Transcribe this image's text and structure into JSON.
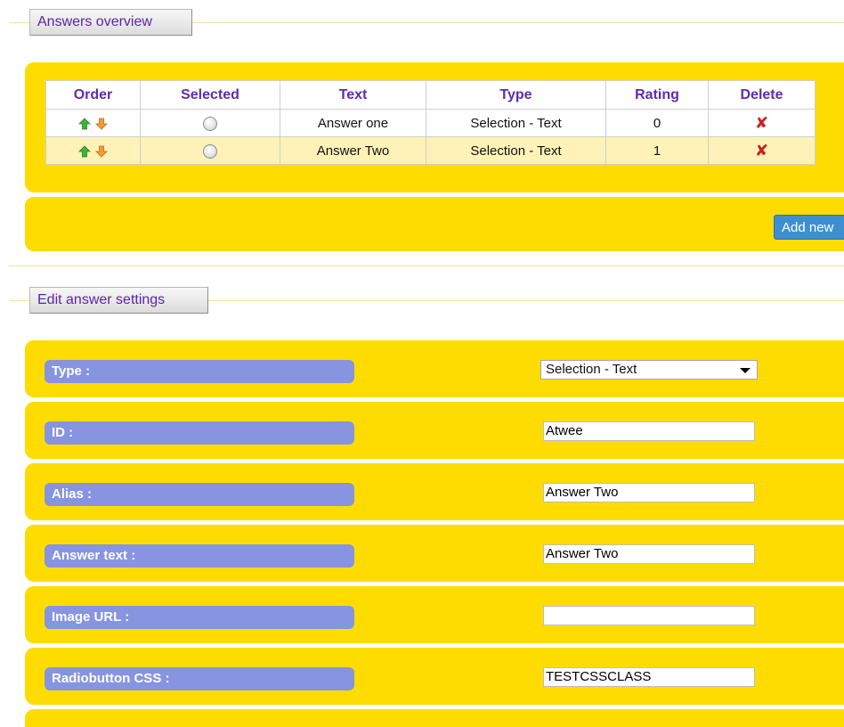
{
  "overview": {
    "legend": "Answers overview",
    "columns": [
      "Order",
      "Selected",
      "Text",
      "Type",
      "Rating",
      "Delete"
    ],
    "rows": [
      {
        "text": "Answer one",
        "type": "Selection - Text",
        "rating": "0",
        "delete_icon": "delete-x-icon"
      },
      {
        "text": "Answer Two",
        "type": "Selection - Text",
        "rating": "1",
        "delete_icon": "delete-x-icon"
      }
    ],
    "delete_glyph": "✘",
    "add_new_label": "Add new"
  },
  "settings": {
    "legend": "Edit answer settings",
    "type_label": "Type :",
    "type_value": "Selection - Text",
    "id_label": "ID :",
    "id_value": "Atwee",
    "alias_label": "Alias :",
    "alias_value": "Answer Two",
    "answer_text_label": "Answer text :",
    "answer_text_value": "Answer Two",
    "image_url_label": "Image URL :",
    "image_url_value": "",
    "radiobutton_css_label": "Radiobutton CSS :",
    "radiobutton_css_value": "TESTCSSCLASS"
  },
  "colors": {
    "panel": "#ffdc00",
    "label_bg": "#8794e0",
    "header_text": "#5a2db3",
    "button_blue": "#3d8fd1",
    "delete_red": "#cc1f1f"
  }
}
